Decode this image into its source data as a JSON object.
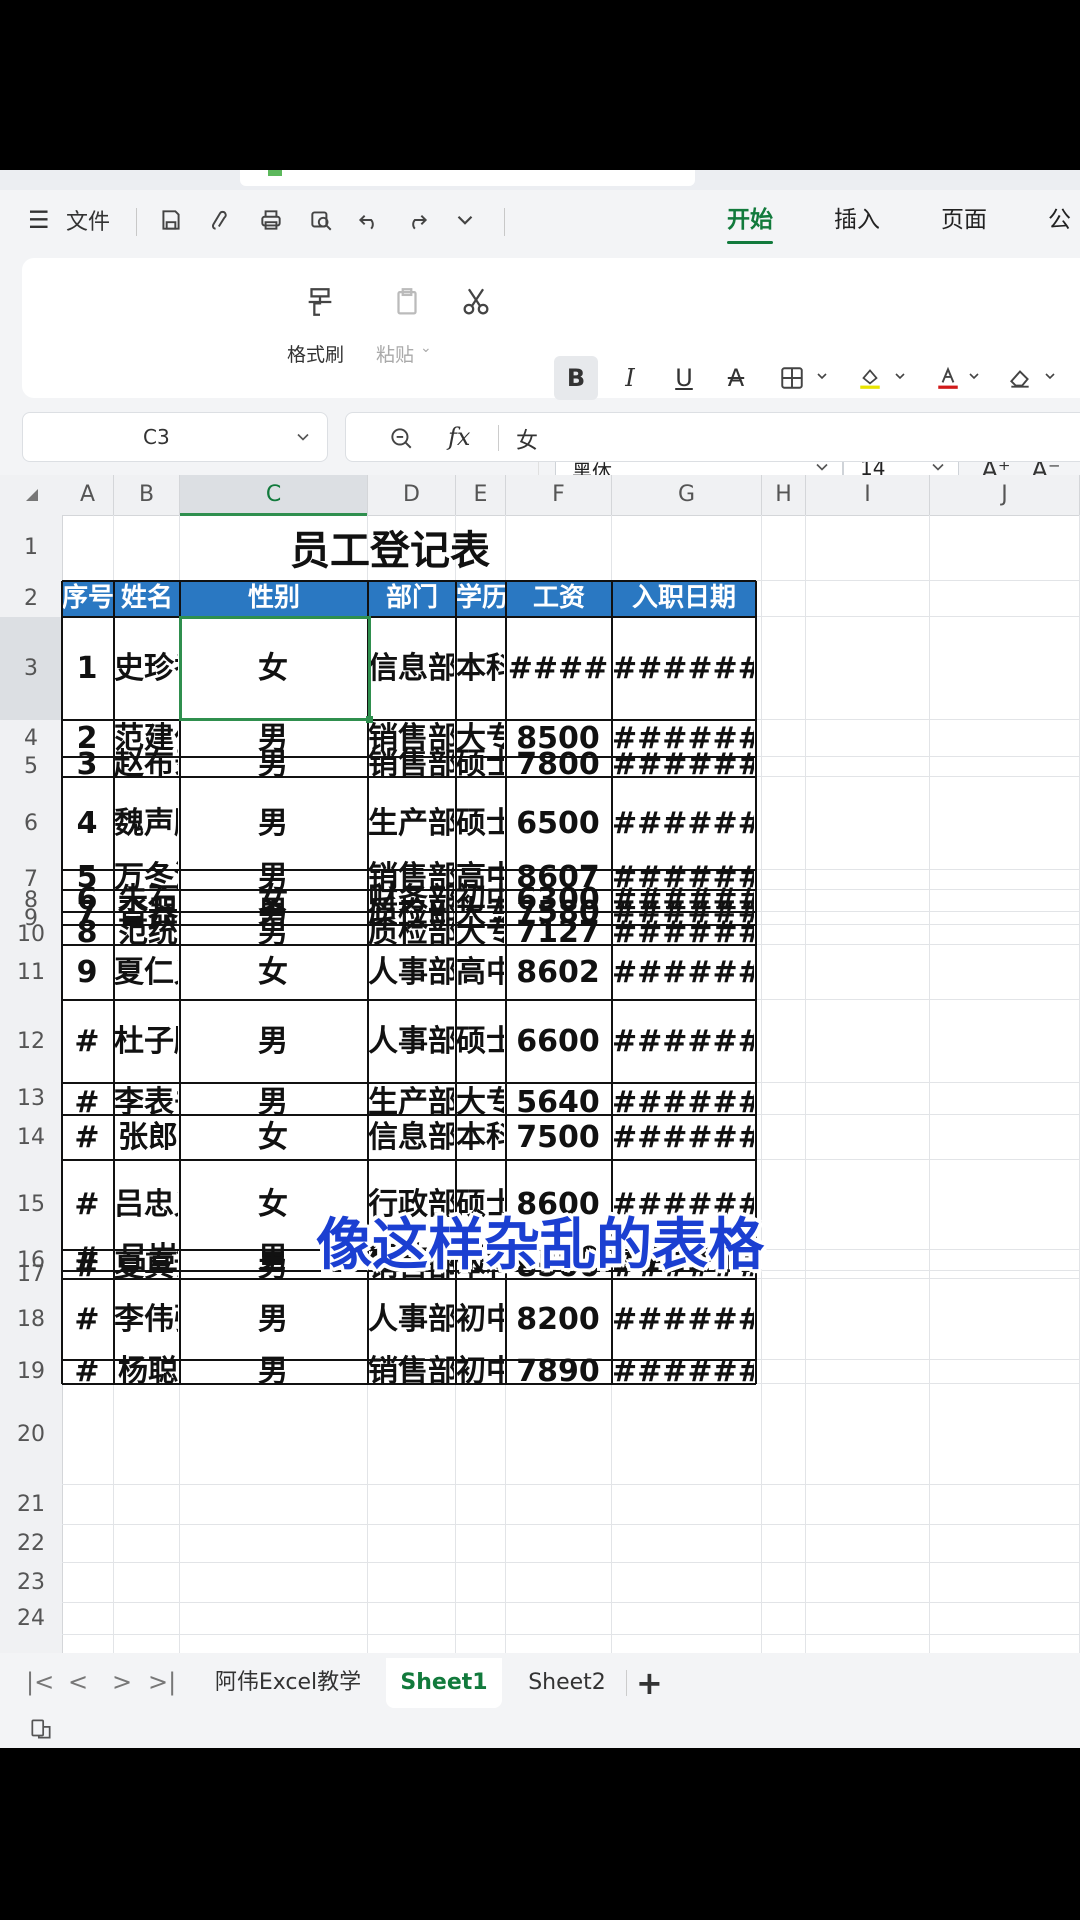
{
  "menu": {
    "file_label": "文件",
    "tabs": [
      "开始",
      "插入",
      "页面",
      "公式"
    ],
    "active_tab": "开始"
  },
  "ribbon": {
    "format_painter_label": "格式刷",
    "paste_label": "粘贴",
    "font_name": "黑体",
    "font_size": "14",
    "bold_label": "B",
    "italic_label": "I",
    "underline_label": "U",
    "strike_label": "A",
    "grow_font_label": "A⁺",
    "shrink_font_label": "A⁻"
  },
  "formula_bar": {
    "cell_ref": "C3",
    "fx_label": "fx",
    "value": "女"
  },
  "columns": [
    "A",
    "B",
    "C",
    "D",
    "E",
    "F",
    "G",
    "H",
    "I",
    "J"
  ],
  "selected_column": "C",
  "rows": [
    "1",
    "2",
    "3",
    "4",
    "5",
    "6",
    "7",
    "8",
    "9",
    "10",
    "11",
    "12",
    "13",
    "14",
    "15",
    "16",
    "17",
    "18",
    "19",
    "20",
    "21",
    "22",
    "23",
    "24"
  ],
  "selected_row": "3",
  "sheet": {
    "title": "员工登记表",
    "header": [
      "序号",
      "姓名",
      "性别",
      "部门",
      "学历",
      "工资",
      "入职日期"
    ],
    "data": [
      {
        "row": "3",
        "a": "1",
        "b": "史珍香",
        "c": "女",
        "d": "信息部",
        "e": "本科",
        "f": "####",
        "g": "######"
      },
      {
        "row": "4",
        "a": "2",
        "b": "范建伟",
        "c": "男",
        "d": "销售部",
        "e": "大专",
        "f": "8500",
        "g": "######"
      },
      {
        "row": "5",
        "a": "3",
        "b": "赵布录",
        "c": "男",
        "d": "销售部",
        "e": "硕士",
        "f": "7800",
        "g": "######"
      },
      {
        "row": "6",
        "a": "4",
        "b": "魏声鹏",
        "c": "男",
        "d": "生产部",
        "e": "硕士",
        "f": "6500",
        "g": "######"
      },
      {
        "row": "7",
        "a": "5",
        "b": "万冬泳",
        "c": "男",
        "d": "销售部",
        "e": "高中",
        "f": "8607",
        "g": "######"
      },
      {
        "row": "8",
        "a": "6",
        "b": "朱石",
        "c": "女",
        "d": "财务部",
        "e": "初中",
        "f": "6300",
        "g": "######"
      },
      {
        "row": "9",
        "a": "7",
        "b": "沓器",
        "c": "男",
        "d": "质检部",
        "e": "大专",
        "f": "7580",
        "g": "######"
      },
      {
        "row": "10",
        "a": "8",
        "b": "范统",
        "c": "男",
        "d": "质检部",
        "e": "大专",
        "f": "7127",
        "g": "######"
      },
      {
        "row": "11",
        "a": "9",
        "b": "夏仁义",
        "c": "女",
        "d": "人事部",
        "e": "高中",
        "f": "8602",
        "g": "######"
      },
      {
        "row": "12",
        "a": "#",
        "b": "杜子腾",
        "c": "男",
        "d": "人事部",
        "e": "硕士",
        "f": "6600",
        "g": "######"
      },
      {
        "row": "13",
        "a": "#",
        "b": "李表书",
        "c": "男",
        "d": "生产部",
        "e": "大专",
        "f": "5640",
        "g": "######"
      },
      {
        "row": "14",
        "a": "#",
        "b": "张郎",
        "c": "女",
        "d": "信息部",
        "e": "本科",
        "f": "7500",
        "g": "######"
      },
      {
        "row": "15",
        "a": "#",
        "b": "吕忠义",
        "c": "女",
        "d": "行政部",
        "e": "硕士",
        "f": "8600",
        "g": "######"
      },
      {
        "row": "16",
        "a": "#",
        "b": "吕豈",
        "c": "男",
        "d": "行政部",
        "e": "初中",
        "f": "6500",
        "g": "######"
      },
      {
        "row": "17",
        "a": "#",
        "b": "夏真诚",
        "c": "男",
        "d": "销售部",
        "e": "本科",
        "f": "8500",
        "g": "######"
      },
      {
        "row": "18",
        "a": "#",
        "b": "李伟强",
        "c": "男",
        "d": "人事部",
        "e": "初中",
        "f": "8200",
        "g": "######"
      },
      {
        "row": "19",
        "a": "#",
        "b": "杨聪",
        "c": "男",
        "d": "销售部",
        "e": "初中",
        "f": "7890",
        "g": "######"
      }
    ]
  },
  "caption": "像这样杂乱的表格",
  "sheet_tabs": [
    "阿伟Excel教学",
    "Sheet1",
    "Sheet2"
  ],
  "active_sheet": "Sheet1",
  "add_sheet_label": "+",
  "colors": {
    "accent": "#127a3c",
    "header_fill": "#2a78c2",
    "caption": "#1b3fd1",
    "selection": "#2f8f4e"
  }
}
